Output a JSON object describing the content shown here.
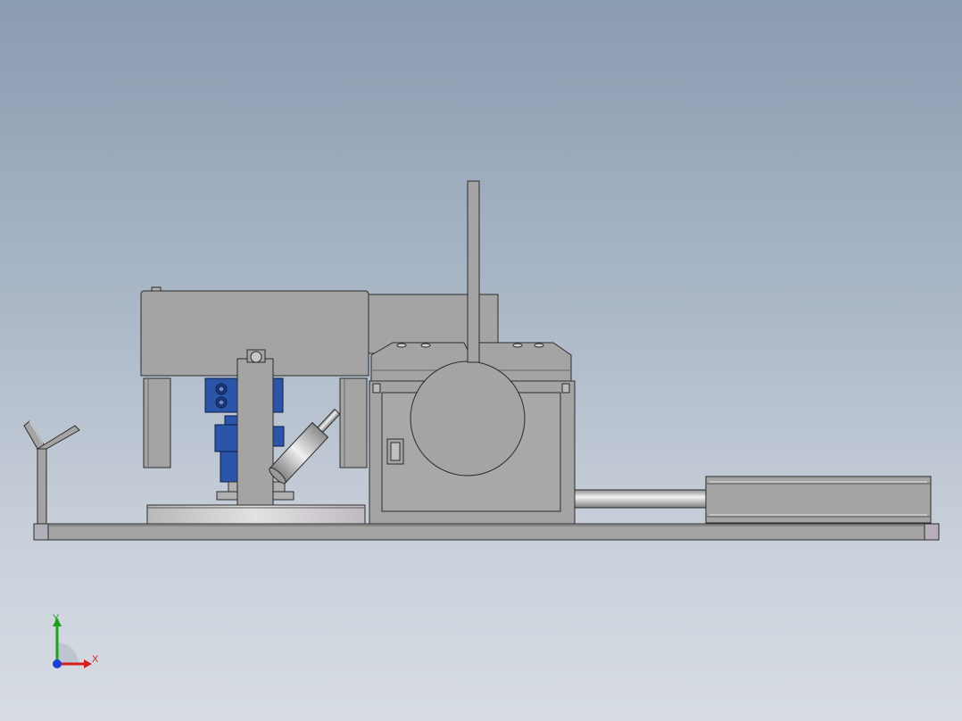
{
  "viewport": {
    "background_top": "#8a9bb0",
    "background_bottom": "#d8dde4"
  },
  "model": {
    "body_color": "#a4a4a4",
    "edge_color": "#2b2b2b",
    "accent_color": "#2b55a8"
  },
  "triad": {
    "y_label": "Y",
    "x_label": "X",
    "y_color": "#1fa01f",
    "x_color": "#d42020",
    "z_color": "#1d3fd6"
  }
}
